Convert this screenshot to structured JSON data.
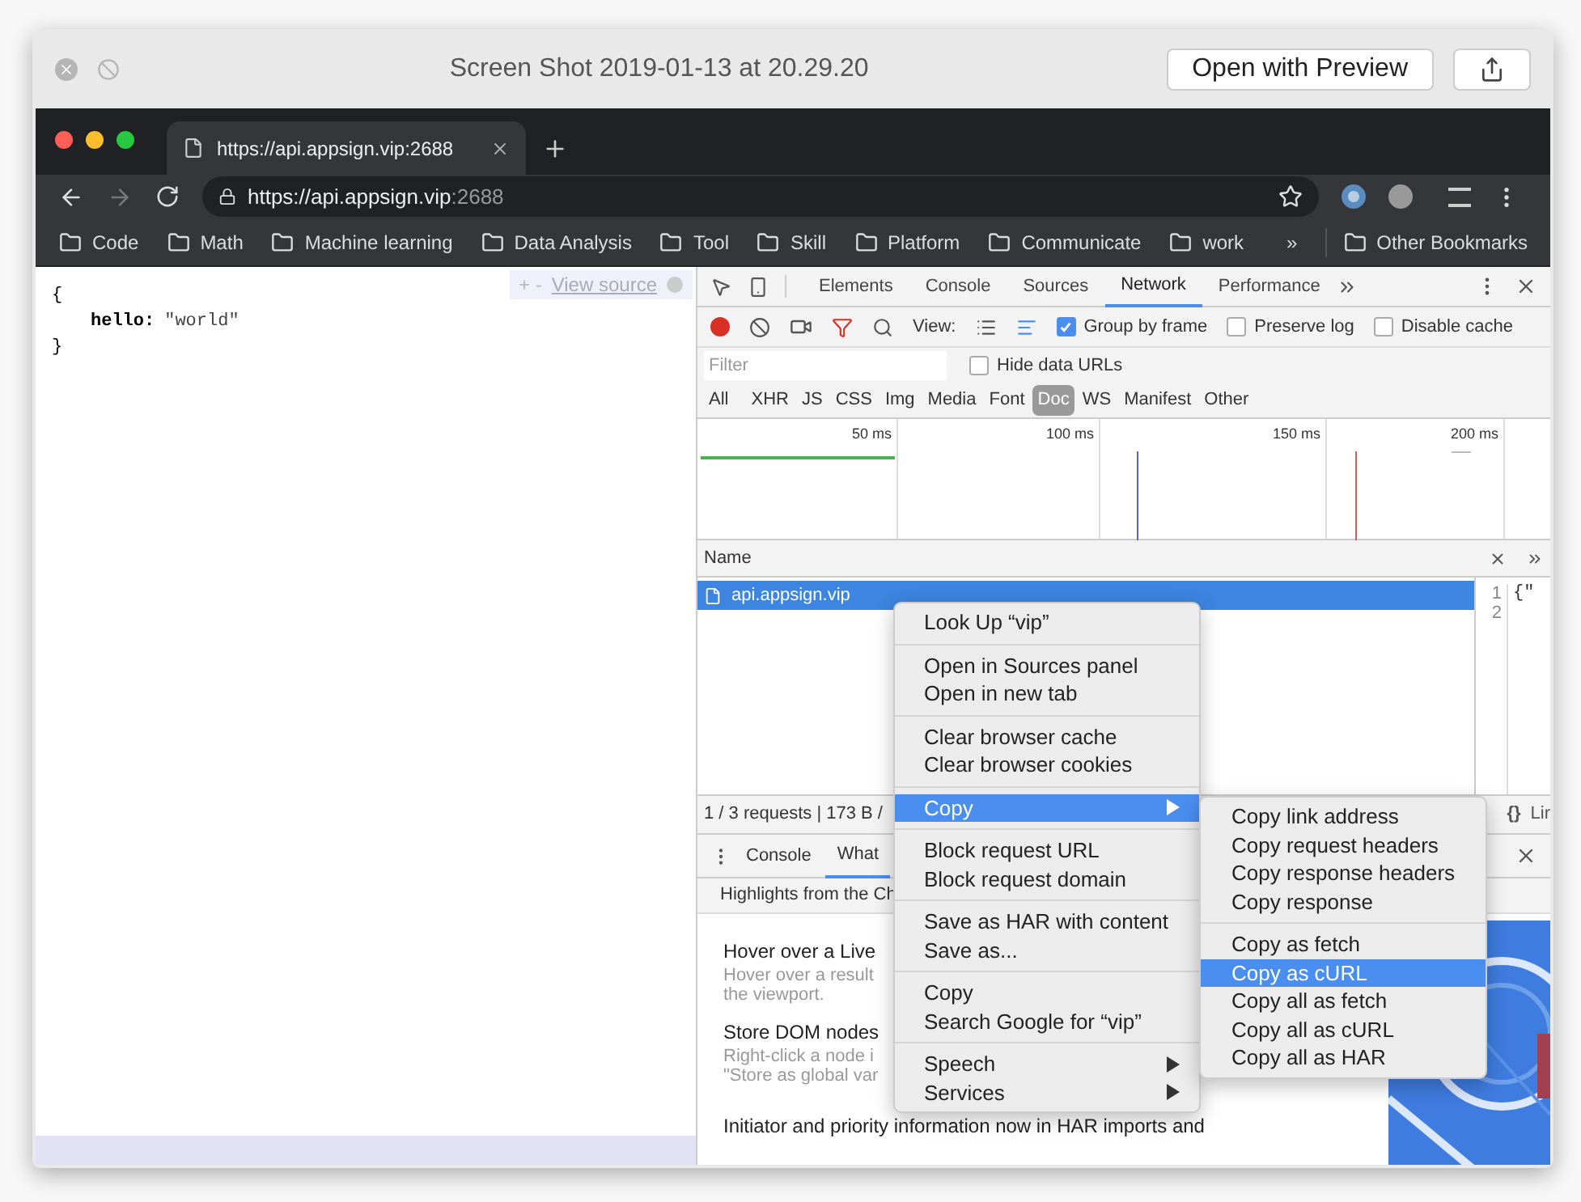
{
  "window": {
    "title": "Screen Shot 2019-01-13 at 20.29.20",
    "open_button": "Open with Preview"
  },
  "browser": {
    "tab_title": "https://api.appsign.vip:2688",
    "url_host": "https://api.appsign.vip",
    "url_port": ":2688",
    "bookmarks": [
      "Code",
      "Math",
      "Machine learning",
      "Data Analysis",
      "Tool",
      "Skill",
      "Platform",
      "Communicate",
      "work"
    ],
    "bookmarks_more": "»",
    "other_bookmarks": "Other Bookmarks"
  },
  "page": {
    "view_source": "View source",
    "zoom_controls": "+ -",
    "json_lines": [
      {
        "kind": "brace",
        "text": "{"
      },
      {
        "kind": "pair",
        "key": "hello:",
        "value": "\"world\""
      },
      {
        "kind": "brace",
        "text": "}"
      }
    ]
  },
  "devtools": {
    "tabs": [
      {
        "label": "Elements",
        "selected": false
      },
      {
        "label": "Console",
        "selected": false
      },
      {
        "label": "Sources",
        "selected": false
      },
      {
        "label": "Network",
        "selected": true
      },
      {
        "label": "Performance",
        "selected": false
      }
    ],
    "view_label": "View:",
    "options": [
      {
        "label": "Group by frame",
        "checked": true
      },
      {
        "label": "Preserve log",
        "checked": false
      },
      {
        "label": "Disable cache",
        "checked": false
      }
    ],
    "filter": {
      "placeholder": "Filter"
    },
    "hide_data_urls": {
      "label": "Hide data URLs",
      "checked": false
    },
    "types": [
      {
        "label": "All",
        "selected": false
      },
      {
        "label": "XHR",
        "selected": false
      },
      {
        "label": "JS",
        "selected": false
      },
      {
        "label": "CSS",
        "selected": false
      },
      {
        "label": "Img",
        "selected": false
      },
      {
        "label": "Media",
        "selected": false
      },
      {
        "label": "Font",
        "selected": false
      },
      {
        "label": "Doc",
        "selected": true
      },
      {
        "label": "WS",
        "selected": false
      },
      {
        "label": "Manifest",
        "selected": false
      },
      {
        "label": "Other",
        "selected": false
      }
    ],
    "timeline_ticks": [
      "50 ms",
      "100 ms",
      "150 ms",
      "200 ms"
    ],
    "name_header": "Name",
    "requests": [
      {
        "name": "api.appsign.vip",
        "selected": true
      }
    ],
    "preview_lines": [
      {
        "number": "1",
        "text": "{\""
      },
      {
        "number": "2"
      }
    ],
    "status": "1 / 3 requests | 173 B /",
    "status_braces": "{}",
    "status_cut": "Lir",
    "drawer_tabs": [
      {
        "label": "Console",
        "selected": false
      },
      {
        "label": "What",
        "selected": true
      }
    ],
    "highlights": "Highlights from the Ch",
    "whats_new": [
      {
        "kind": "title",
        "text": "Hover over a Live"
      },
      {
        "kind": "body",
        "text": "Hover over a result"
      },
      {
        "kind": "body",
        "text": "the viewport."
      },
      {
        "kind": "title",
        "text": "Store DOM nodes"
      },
      {
        "kind": "body",
        "text": "Right-click a node i"
      },
      {
        "kind": "body",
        "text": "\"Store as global var"
      },
      {
        "kind": "title",
        "text": "Initiator and priority information now in HAR imports and"
      }
    ]
  },
  "context_menu": {
    "groups": [
      [
        {
          "label": "Look Up “vip”",
          "selected": false,
          "submenu": false
        }
      ],
      [
        {
          "label": "Open in Sources panel",
          "selected": false,
          "submenu": false
        },
        {
          "label": "Open in new tab",
          "selected": false,
          "submenu": false
        }
      ],
      [
        {
          "label": "Clear browser cache",
          "selected": false,
          "submenu": false
        },
        {
          "label": "Clear browser cookies",
          "selected": false,
          "submenu": false
        }
      ],
      [
        {
          "label": "Copy",
          "selected": true,
          "submenu": true
        }
      ],
      [
        {
          "label": "Block request URL",
          "selected": false,
          "submenu": false
        },
        {
          "label": "Block request domain",
          "selected": false,
          "submenu": false
        }
      ],
      [
        {
          "label": "Save as HAR with content",
          "selected": false,
          "submenu": false
        },
        {
          "label": "Save as...",
          "selected": false,
          "submenu": false
        }
      ],
      [
        {
          "label": "Copy",
          "selected": false,
          "submenu": false
        },
        {
          "label": "Search Google for “vip”",
          "selected": false,
          "submenu": false
        }
      ],
      [
        {
          "label": "Speech",
          "selected": false,
          "submenu": true
        },
        {
          "label": "Services",
          "selected": false,
          "submenu": true
        }
      ]
    ],
    "submenu": [
      [
        {
          "label": "Copy link address",
          "selected": false
        },
        {
          "label": "Copy request headers",
          "selected": false
        },
        {
          "label": "Copy response headers",
          "selected": false
        },
        {
          "label": "Copy response",
          "selected": false
        }
      ],
      [
        {
          "label": "Copy as fetch",
          "selected": false
        },
        {
          "label": "Copy as cURL",
          "selected": true
        },
        {
          "label": "Copy all as fetch",
          "selected": false
        },
        {
          "label": "Copy all as cURL",
          "selected": false
        },
        {
          "label": "Copy all as HAR",
          "selected": false
        }
      ]
    ]
  }
}
